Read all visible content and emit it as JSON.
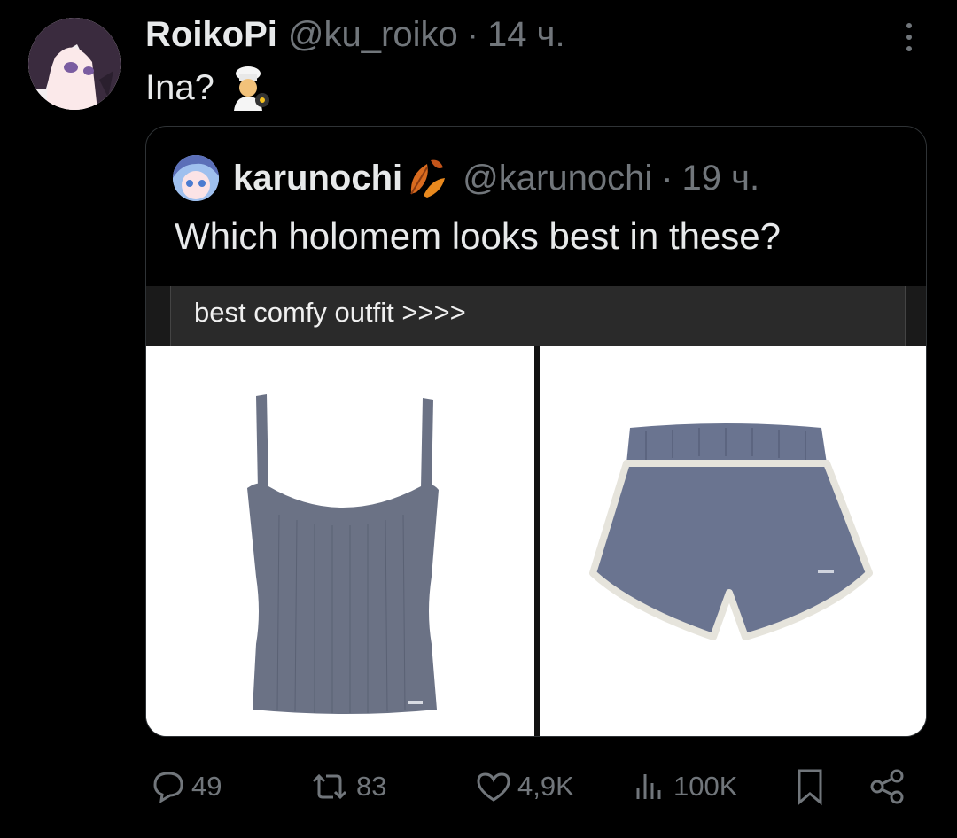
{
  "tweet": {
    "author_name": "RoikoPi",
    "author_handle": "@ku_roiko",
    "separator": "·",
    "time": "14 ч.",
    "text": "Ina?",
    "emoji_name": "cook-emoji"
  },
  "quoted": {
    "author_name": "karunochi",
    "author_emoji_name": "autumn-leaves-emoji",
    "author_handle": "@karunochi",
    "separator": "·",
    "time": "19 ч.",
    "text": "Which holomem looks best in these?",
    "media": {
      "caption": "best comfy outfit >>>>",
      "images": [
        {
          "name": "tank-top-image",
          "color": "#6b7285"
        },
        {
          "name": "shorts-image",
          "color": "#6a7490"
        }
      ]
    }
  },
  "actions": {
    "replies": "49",
    "reposts": "83",
    "likes": "4,9K",
    "views": "100K"
  },
  "colors": {
    "background": "#000000",
    "text_primary": "#e7e9ea",
    "text_secondary": "#71767b",
    "border": "#2f3336"
  }
}
